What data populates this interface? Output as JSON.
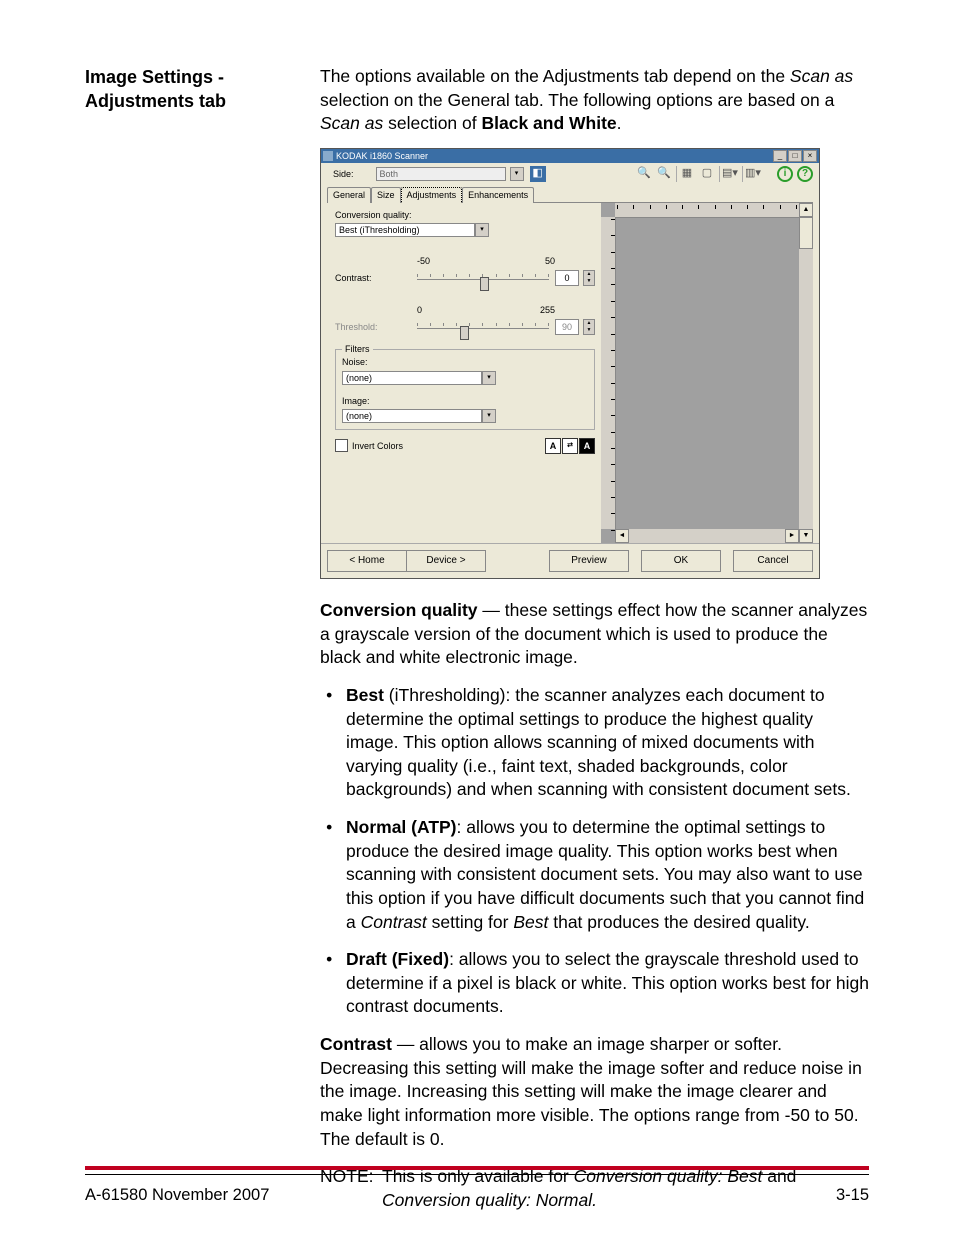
{
  "side_heading": "Image Settings - Adjustments tab",
  "intro": {
    "pre": "The options available on the Adjustments tab depend on the ",
    "scanas1": "Scan as",
    "mid1": " selection on the General tab. The following options are based on a ",
    "scanas2": "Scan as",
    "mid2": " selection of ",
    "bw": "Black and White",
    "end": "."
  },
  "window": {
    "title": "KODAK i1860 Scanner",
    "side_label": "Side:",
    "side_value": "Both",
    "tabs": {
      "general": "General",
      "size": "Size",
      "adjustments": "Adjustments",
      "enhancements": "Enhancements"
    },
    "conv_quality_label": "Conversion quality:",
    "conv_quality_value": "Best (iThresholding)",
    "contrast_label": "Contrast:",
    "contrast_min": "-50",
    "contrast_max": "50",
    "contrast_value": "0",
    "threshold_label": "Threshold:",
    "threshold_min": "0",
    "threshold_max": "255",
    "threshold_value": "90",
    "filters_legend": "Filters",
    "noise_label": "Noise:",
    "noise_value": "(none)",
    "image_label": "Image:",
    "image_value": "(none)",
    "invert_label": "Invert Colors",
    "btn_home": "< Home",
    "btn_device": "Device >",
    "btn_preview": "Preview",
    "btn_ok": "OK",
    "btn_cancel": "Cancel"
  },
  "body": {
    "convq_lead": "Conversion quality",
    "convq_rest": " — these settings effect how the scanner analyzes a grayscale version of the document which is used to produce the black and white electronic image.",
    "best_lead": "Best",
    "best_rest": " (iThresholding): the scanner analyzes each document to determine the optimal settings to produce the highest quality image. This option allows scanning of mixed documents with varying quality (i.e., faint text, shaded backgrounds, color backgrounds) and when scanning with consistent document sets.",
    "normal_lead": "Normal (ATP)",
    "normal_rest1": ": allows you to determine the optimal settings to produce the desired image quality. This option works best when scanning with consistent document sets. You may also want to use this option if you have difficult documents such that you cannot find a ",
    "normal_contrast": "Contrast",
    "normal_rest2": " setting for ",
    "normal_best": "Best",
    "normal_rest3": " that produces the desired quality.",
    "draft_lead": "Draft (Fixed)",
    "draft_rest": ": allows you to select the grayscale threshold used to determine if a pixel is black or white. This option works best for high contrast documents.",
    "contrast_lead": "Contrast",
    "contrast_rest": " — allows you to make an image sharper or softer. Decreasing this setting will make the image softer and reduce noise in the image. Increasing this setting will make the image clearer and make light information more visible. The options range from -50 to 50. The default is 0.",
    "note_label": "NOTE:",
    "note_pre": "This is only available for ",
    "note_i1": "Conversion quality: Best",
    "note_and": " and ",
    "note_i2": "Conversion quality: Normal.",
    "note_end": ""
  },
  "footer": {
    "left": "A-61580   November 2007",
    "right": "3-15"
  }
}
